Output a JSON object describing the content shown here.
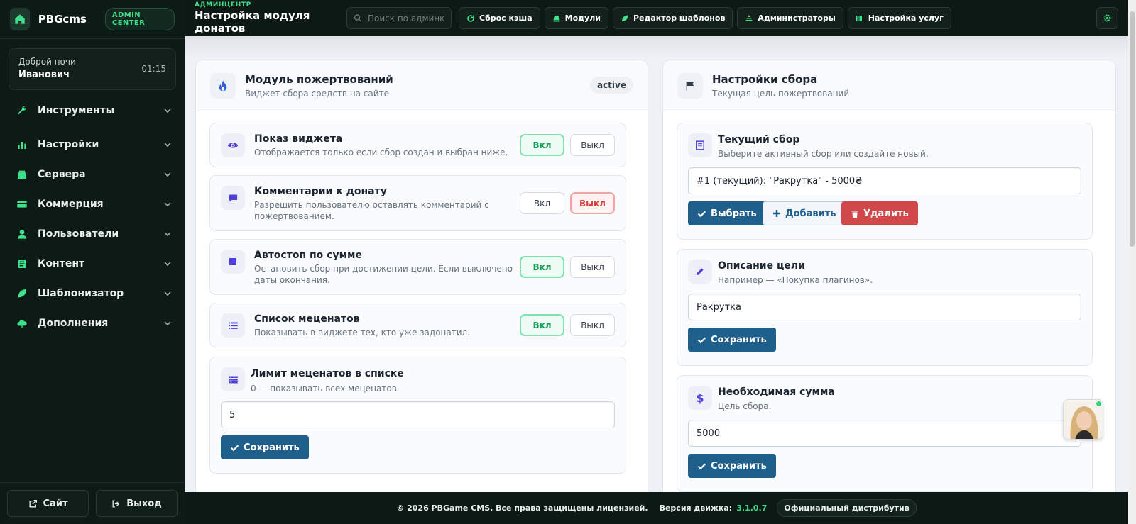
{
  "brand": {
    "name": "PBGcms",
    "badge": "ADMIN CENTER"
  },
  "greeting": {
    "line": "Доброй ночи",
    "name": "Иванович",
    "time": "01:15"
  },
  "sidebar": {
    "items": [
      {
        "label": "Инструменты",
        "icon": "wrench-icon"
      },
      {
        "label": "Настройки",
        "icon": "sliders-icon"
      },
      {
        "label": "Сервера",
        "icon": "server-icon"
      },
      {
        "label": "Коммерция",
        "icon": "card-icon"
      },
      {
        "label": "Пользователи",
        "icon": "user-icon"
      },
      {
        "label": "Контент",
        "icon": "document-icon"
      },
      {
        "label": "Шаблонизатор",
        "icon": "leaf-icon"
      },
      {
        "label": "Дополнения",
        "icon": "cloud-icon"
      }
    ],
    "site_label": "Сайт",
    "logout_label": "Выход"
  },
  "topbar": {
    "kicker": "АДМИНЦЕНТР",
    "title": "Настройка модуля донатов",
    "search_placeholder": "Поиск по админке",
    "buttons": [
      {
        "label": "Сброс кэша",
        "icon": "refresh-icon"
      },
      {
        "label": "Модули",
        "icon": "package-icon"
      },
      {
        "label": "Редактор шаблонов",
        "icon": "leaf-icon"
      },
      {
        "label": "Администраторы",
        "icon": "admin-icon"
      },
      {
        "label": "Настройка услуг",
        "icon": "barcode-icon"
      }
    ]
  },
  "left_card": {
    "title": "Модуль пожертвований",
    "subtitle": "Виджет сбора средств на сайте",
    "status": "active",
    "options": [
      {
        "title": "Показ виджета",
        "desc": "Отображается только если сбор создан и выбран ниже.",
        "on": "Вкл",
        "off": "Выкл",
        "state": "on"
      },
      {
        "title": "Комментарии к донату",
        "desc1": "Разрешить пользователю оставлять комментарий с",
        "desc2": "пожертвованием.",
        "on": "Вкл",
        "off": "Выкл",
        "state": "off"
      },
      {
        "title": "Автостоп по сумме",
        "desc1": "Остановить сбор при достижении цели. Если выключено — до",
        "desc2": "даты окончания.",
        "on": "Вкл",
        "off": "Выкл",
        "state": "on"
      },
      {
        "title": "Список меценатов",
        "desc": "Показывать в виджете тех, кто уже задонатил.",
        "on": "Вкл",
        "off": "Выкл",
        "state": "on"
      }
    ],
    "limit": {
      "title": "Лимит меценатов в списке",
      "desc": "0 — показывать всех меценатов.",
      "value": "5",
      "save": "Сохранить"
    }
  },
  "right_card": {
    "title": "Настройки сбора",
    "subtitle": "Текущая цель пожертвований",
    "current": {
      "title": "Текущий сбор",
      "desc": "Выберите активный сбор или создайте новый.",
      "value": "#1 (текущий): \"Ракрутка\" - 5000₴",
      "select": "Выбрать",
      "add": "Добавить",
      "delete": "Удалить"
    },
    "goal": {
      "title": "Описание цели",
      "desc": "Например — «Покупка плагинов».",
      "value": "Ракрутка",
      "save": "Сохранить"
    },
    "amount": {
      "title": "Необходимая сумма",
      "desc": "Цель сбора.",
      "value": "5000",
      "save": "Сохранить"
    }
  },
  "footer": {
    "copyright": "© 2026 PBGame CMS. Все права защищены лицензией.",
    "version_label": "Версия движка:",
    "version": "3.1.0.7",
    "distributor": "Официальный дистрибутив"
  },
  "colors": {
    "accent": "#3ee08b",
    "primary_button": "#1f5f8b",
    "danger": "#d04848",
    "sidebar_bg": "#0e1a16"
  }
}
